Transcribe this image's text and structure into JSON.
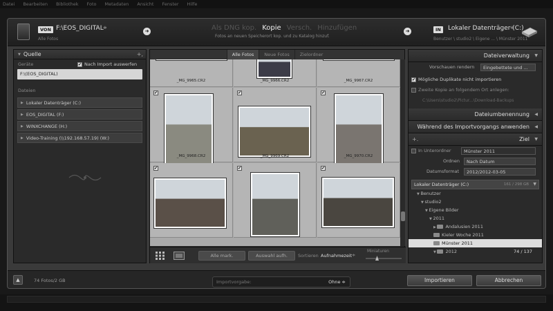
{
  "menubar": [
    "Datei",
    "Bearbeiten",
    "Bibliothek",
    "Foto",
    "Metadaten",
    "Ansicht",
    "Fenster",
    "Hilfe"
  ],
  "header": {
    "from_badge": "VON",
    "source_path": "F:\\EOS_DIGITAL",
    "source_caret": "≑",
    "source_sub": "Alle Fotos",
    "modes": [
      {
        "label": "Als DNG kop.",
        "active": false
      },
      {
        "label": "Kopie",
        "active": true
      },
      {
        "label": "Versch.",
        "active": false
      },
      {
        "label": "Hinzufügen",
        "active": false
      }
    ],
    "mode_desc": "Fotos an neuen Speicherort kop. und zu Katalog hinzuf.",
    "in_badge": "IN",
    "dest_title": "Lokaler Datenträger (C:)",
    "dest_caret": "≑",
    "dest_sub": "Benutzer \\ studio2 \\ Eigene ... \\ Münster 2011"
  },
  "left": {
    "title": "Quelle",
    "plus": "+,",
    "devices_label": "Geräte",
    "eject_label": "Nach Import auswerfen",
    "eject_checked": "✔",
    "selected_source": "F:\\(EOS_DIGITAL)",
    "files_label": "Dateien",
    "drives": [
      "Lokaler Datenträger (C:)",
      "EOS_DIGITAL (F:)",
      "WINXCHANGE (H:)",
      "Video-Training (\\\\192.168.57.19) (W:)"
    ]
  },
  "center": {
    "tabs": [
      {
        "label": "Alle Fotos",
        "active": true
      },
      {
        "label": "Neue Fotos",
        "active": false
      },
      {
        "label": "Zielordner",
        "active": false
      }
    ],
    "photos": [
      {
        "name": "_MG_9965.CR2"
      },
      {
        "name": "_MG_9966.CR2"
      },
      {
        "name": "_MG_9967.CR2"
      },
      {
        "name": "_MG_9968.CR2"
      },
      {
        "name": "_MG_9969.CR2"
      },
      {
        "name": "_MG_9970.CR2"
      },
      {
        "name": ""
      },
      {
        "name": ""
      },
      {
        "name": ""
      }
    ],
    "check_mark": "✔",
    "btn_all": "Alle mark.",
    "btn_none": "Auswahl aufh.",
    "sort_label": "Sortieren",
    "sort_value": "Aufnahmezeit",
    "thumb_label": "Miniaturen"
  },
  "right": {
    "dateiverwaltung": "Dateiverwaltung",
    "vorschauen_label": "Vorschauen rendern",
    "vorschauen_value": "Eingebettete und ...",
    "no_dupes": "Mögliche Duplikate nicht importieren",
    "second_copy": "Zweite Kopie an folgendem Ort anlegen:",
    "second_path": "C:\\Users\\studio2\\Pictur...\\Download-Backups",
    "dateiumbenennung": "Dateiumbenennung",
    "waehrend": "Während des Importvorgangs anwenden",
    "ziel": "Ziel",
    "ziel_plus": "+.",
    "in_unterordner": "In Unterordner",
    "unterordner_value": "Münster 2011",
    "ordnen_label": "Ordnen",
    "ordnen_value": "Nach Datum",
    "datumsformat_label": "Datumsformat",
    "datumsformat_value": "2012/2012-03-05",
    "volume": "Lokaler Datenträger (C:)",
    "volume_size": "161 / 298 GB",
    "tree": [
      {
        "label": "Benutzer",
        "indent": 0,
        "arrow": "▼",
        "folder": false,
        "hl": false,
        "count": ""
      },
      {
        "label": "studio2",
        "indent": 1,
        "arrow": "▼",
        "folder": false,
        "hl": false,
        "count": ""
      },
      {
        "label": "Eigene Bilder",
        "indent": 2,
        "arrow": "▼",
        "folder": false,
        "hl": false,
        "count": ""
      },
      {
        "label": "2011",
        "indent": 3,
        "arrow": "▼",
        "folder": false,
        "hl": false,
        "count": ""
      },
      {
        "label": "Andalusien 2011",
        "indent": 4,
        "arrow": "▶",
        "folder": true,
        "hl": false,
        "count": ""
      },
      {
        "label": "Kieler Woche 2011",
        "indent": 4,
        "arrow": "",
        "folder": true,
        "hl": false,
        "count": ""
      },
      {
        "label": "Münster 2011",
        "indent": 4,
        "arrow": "",
        "folder": true,
        "hl": true,
        "count": ""
      },
      {
        "label": "2012",
        "indent": 4,
        "arrow": "▼",
        "folder": true,
        "hl": false,
        "count": "74 / 137"
      }
    ]
  },
  "bottom": {
    "count": "74 Fotos/2 GB",
    "preset_label": "Importvorgabe:",
    "preset_value": "Ohne ≑",
    "import_btn": "Importieren",
    "cancel_btn": "Abbrechen"
  },
  "colors": {
    "accent": "#dddddd",
    "panel": "#2a2a2a",
    "grid": "#aaaaaa"
  }
}
